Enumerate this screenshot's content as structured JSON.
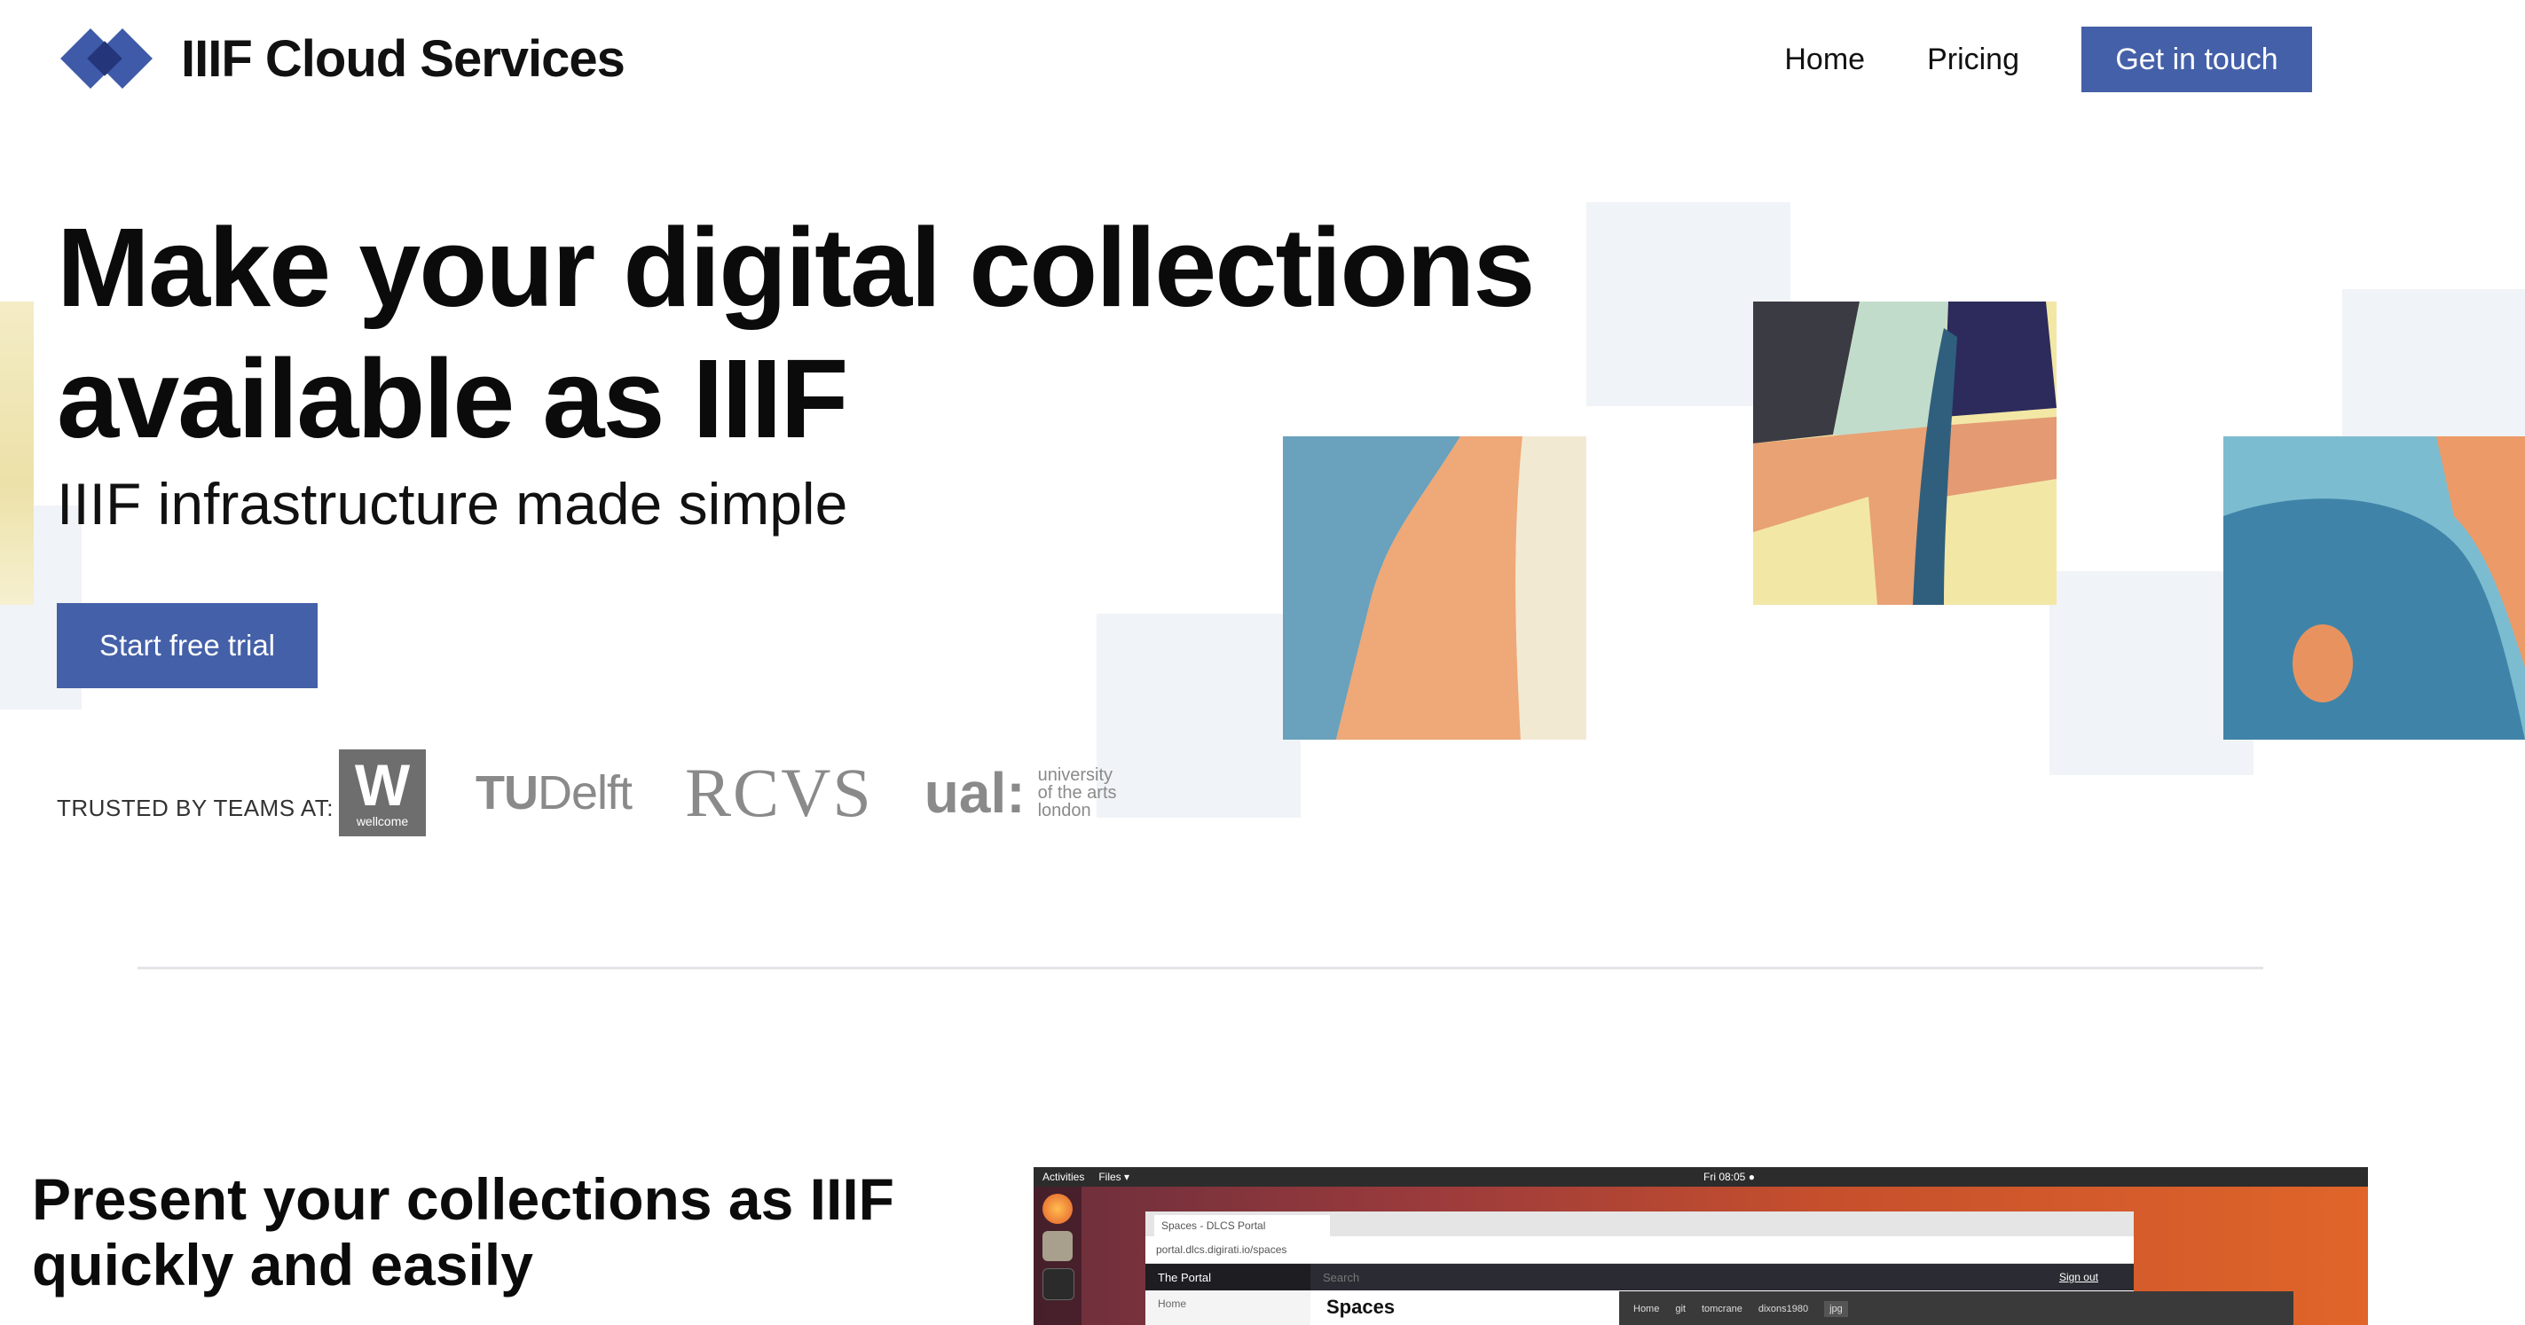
{
  "header": {
    "brand": "IIIF Cloud Services",
    "nav": [
      "Home",
      "Pricing"
    ],
    "cta": "Get in touch"
  },
  "hero": {
    "title": "Make your digital collections available as IIIF",
    "subtitle": "IIIF infrastructure made simple",
    "trial_button": "Start free trial",
    "trusted_label": "TRUSTED BY TEAMS AT:",
    "logos": {
      "wellcome_mark": "W",
      "wellcome_text": "wellcome",
      "tudelft_a": "TU",
      "tudelft_b": "Delft",
      "rcvs": "RCVS",
      "ual_mark": "ual:",
      "ual_line1": "university",
      "ual_line2": "of the arts",
      "ual_line3": "london"
    }
  },
  "section": {
    "title": "Present your collections as IIIF quickly and easily"
  },
  "screenshot": {
    "activities": "Activities",
    "files_menu": "Files ▾",
    "clock": "Fri 08:05 ●",
    "tab_title": "Spaces - DLCS Portal",
    "url": "portal.dlcs.digirati.io/spaces",
    "portal_title": "The Portal",
    "search": "Search",
    "sign_out": "Sign out",
    "sidebar_home": "Home",
    "main_heading": "Spaces",
    "files_path": [
      "Home",
      "git",
      "tomcrane",
      "dixons1980",
      "jpg"
    ]
  },
  "colors": {
    "accent": "#4460a8",
    "block": "#f0f3f7"
  }
}
